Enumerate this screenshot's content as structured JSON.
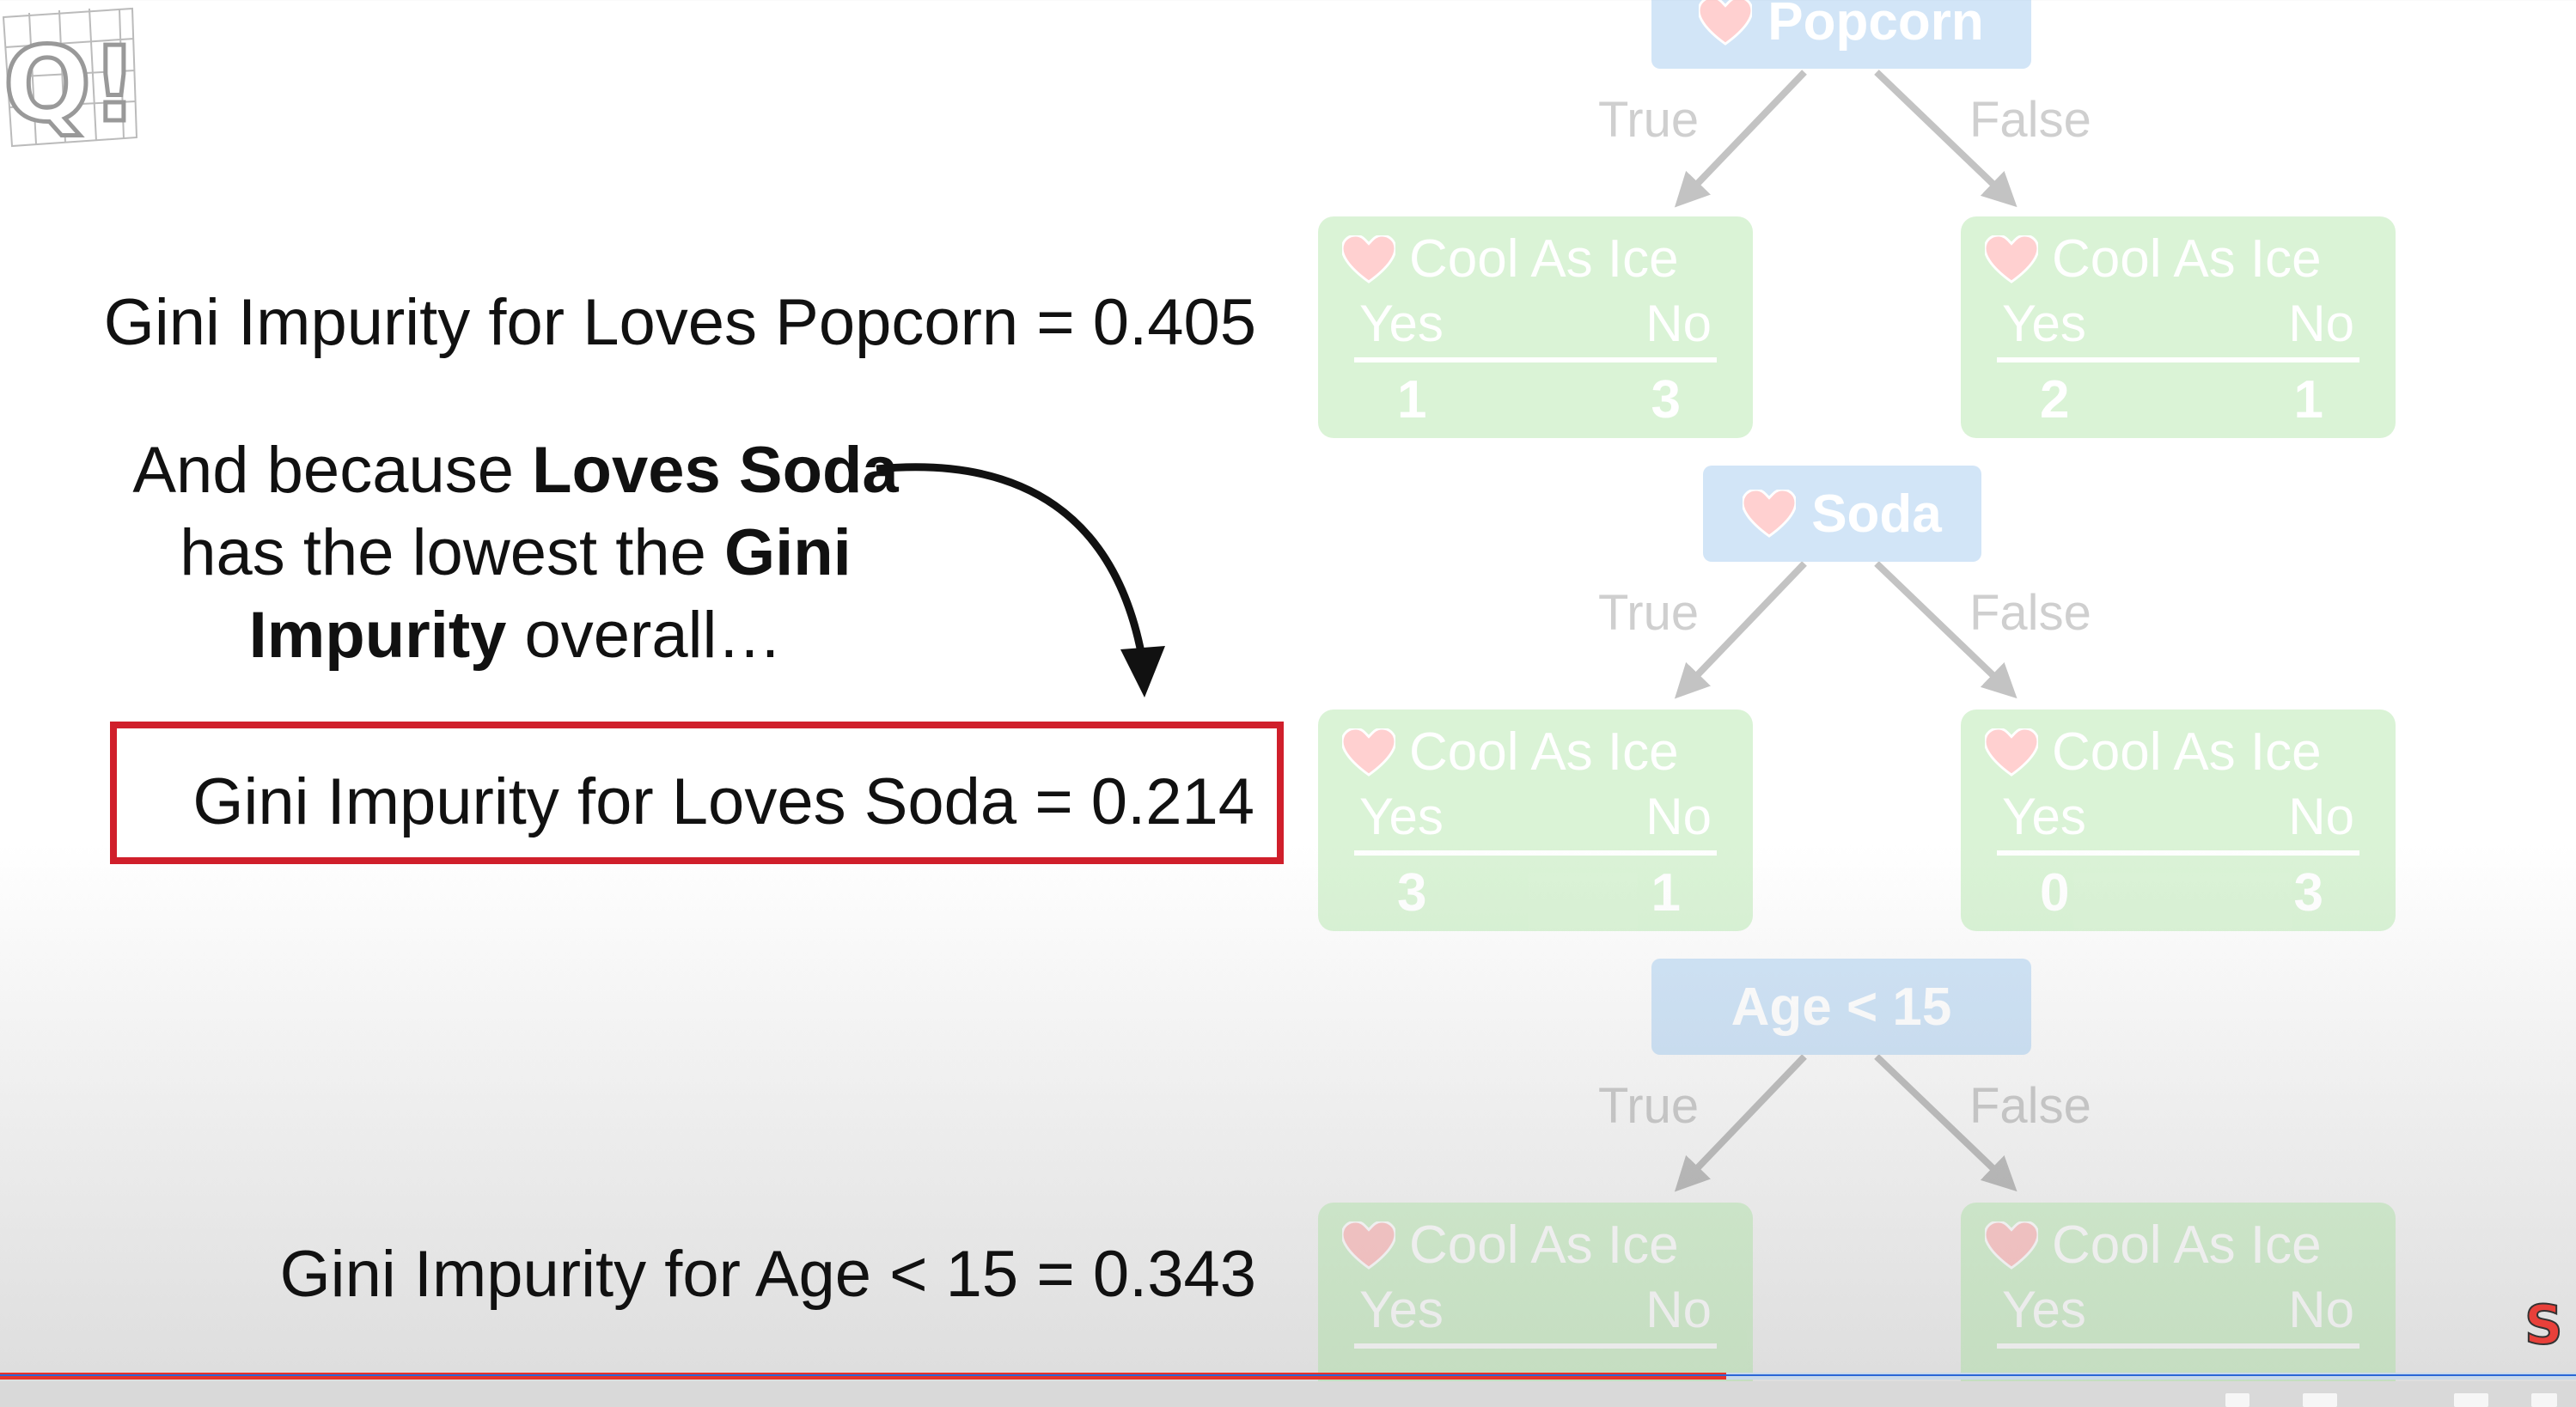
{
  "gini": {
    "popcorn": "Gini Impurity for Loves Popcorn = 0.405",
    "soda": "Gini Impurity for Loves Soda = 0.214",
    "age": "Gini Impurity for Age < 15 = 0.343"
  },
  "caption": {
    "p1": "And because ",
    "b1": "Loves Soda",
    "p2": " has the lowest the ",
    "b2": "Gini Impurity",
    "p3": " overall…"
  },
  "tree": {
    "root_popcorn": "Popcorn",
    "root_soda": "Soda",
    "root_age": "Age < 15",
    "true_label": "True",
    "false_label": "False",
    "leaf_title": "Cool As Ice",
    "yes": "Yes",
    "no": "No",
    "popcorn_true": [
      "1",
      "3"
    ],
    "popcorn_false": [
      "2",
      "1"
    ],
    "soda_true": [
      "3",
      "1"
    ],
    "soda_false": [
      "0",
      "3"
    ]
  },
  "colors": {
    "highlight_box": "#d01f2b",
    "node_blue": "#7fb6ea",
    "leaf_green": "#98de8d"
  },
  "player": {
    "progress_fraction": 0.67
  }
}
